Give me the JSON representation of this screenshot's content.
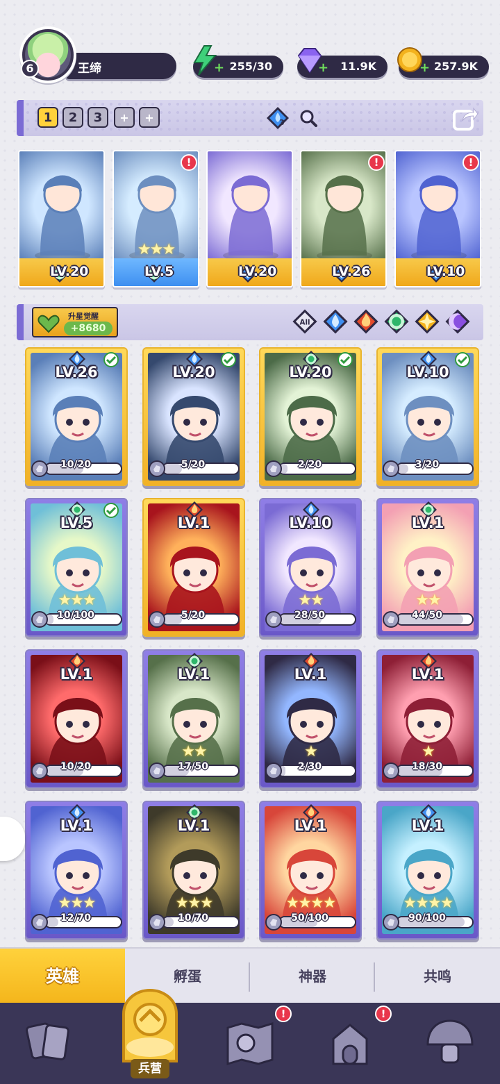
{
  "player": {
    "level": "6",
    "name": "王缔"
  },
  "resources": [
    {
      "key": "energy",
      "value": "255/30",
      "icon": "lightning-icon",
      "color": "#3fd07a"
    },
    {
      "key": "gems",
      "value": "11.9K",
      "icon": "gem-icon",
      "color": "#8a63f0"
    },
    {
      "key": "gold",
      "value": "257.9K",
      "icon": "coin-icon",
      "color": "#f3b21d"
    }
  ],
  "team_bar": {
    "tabs": [
      "1",
      "2",
      "3",
      "+",
      "+"
    ],
    "active_tab": "1",
    "element_count": "3"
  },
  "team_slots": [
    {
      "level": "LV.20",
      "element": "nature",
      "bar": "gold",
      "alert": false
    },
    {
      "level": "LV.5",
      "element": "nature",
      "bar": "blue",
      "alert": true,
      "stars": "★★★"
    },
    {
      "level": "LV.20",
      "element": "water",
      "bar": "gold",
      "alert": false
    },
    {
      "level": "LV.26",
      "element": "water",
      "bar": "gold",
      "alert": true
    },
    {
      "level": "LV.10",
      "element": "water",
      "bar": "gold",
      "alert": true
    }
  ],
  "filter_bar": {
    "awaken_title": "升星觉醒",
    "awaken_value": "+8680",
    "filters": [
      "All",
      "water",
      "fire",
      "nature",
      "light",
      "dark"
    ]
  },
  "heroes": [
    {
      "level": "LV.26",
      "shards": "10/20",
      "progress": 0.5,
      "element": "water",
      "frame": "gold",
      "checked": true,
      "stars": ""
    },
    {
      "level": "LV.20",
      "shards": "5/20",
      "progress": 0.25,
      "element": "water",
      "frame": "gold",
      "checked": true,
      "stars": ""
    },
    {
      "level": "LV.20",
      "shards": "2/20",
      "progress": 0.1,
      "element": "nature",
      "frame": "gold",
      "checked": true,
      "stars": ""
    },
    {
      "level": "LV.10",
      "shards": "3/20",
      "progress": 0.15,
      "element": "water",
      "frame": "gold",
      "checked": true,
      "stars": ""
    },
    {
      "level": "LV.5",
      "shards": "10/100",
      "progress": 0.1,
      "element": "nature",
      "frame": "purple",
      "checked": true,
      "stars": "★★★"
    },
    {
      "level": "LV.1",
      "shards": "5/20",
      "progress": 0.25,
      "element": "fire",
      "frame": "gold",
      "checked": false,
      "stars": ""
    },
    {
      "level": "LV.10",
      "shards": "28/50",
      "progress": 0.56,
      "element": "water",
      "frame": "purple",
      "checked": false,
      "stars": "★★"
    },
    {
      "level": "LV.1",
      "shards": "44/50",
      "progress": 0.88,
      "element": "nature",
      "frame": "purple",
      "checked": false,
      "stars": "★★"
    },
    {
      "level": "LV.1",
      "shards": "10/20",
      "progress": 0.5,
      "element": "fire",
      "frame": "purple",
      "checked": false,
      "stars": ""
    },
    {
      "level": "LV.1",
      "shards": "17/50",
      "progress": 0.34,
      "element": "nature",
      "frame": "purple",
      "checked": false,
      "stars": "★★"
    },
    {
      "level": "LV.1",
      "shards": "2/30",
      "progress": 0.07,
      "element": "fire",
      "frame": "purple",
      "checked": false,
      "stars": "★"
    },
    {
      "level": "LV.1",
      "shards": "18/30",
      "progress": 0.6,
      "element": "fire",
      "frame": "purple",
      "checked": false,
      "stars": "★"
    },
    {
      "level": "LV.1",
      "shards": "12/70",
      "progress": 0.17,
      "element": "water",
      "frame": "purple",
      "checked": false,
      "stars": "★★★"
    },
    {
      "level": "LV.1",
      "shards": "10/70",
      "progress": 0.14,
      "element": "nature",
      "frame": "purple",
      "checked": false,
      "stars": "★★★"
    },
    {
      "level": "LV.1",
      "shards": "50/100",
      "progress": 0.5,
      "element": "fire",
      "frame": "purple",
      "checked": false,
      "stars": "★★★★"
    },
    {
      "level": "LV.1",
      "shards": "90/100",
      "progress": 0.9,
      "element": "water",
      "frame": "purple",
      "checked": false,
      "stars": "★★★★"
    }
  ],
  "subtabs": [
    "英雄",
    "孵蛋",
    "神器",
    "共鸣"
  ],
  "navbar": [
    {
      "icon": "cards-icon",
      "label": "",
      "alert": false
    },
    {
      "icon": "barracks-icon",
      "label": "兵营",
      "alert": false,
      "active": true
    },
    {
      "icon": "map-icon",
      "label": "",
      "alert": true
    },
    {
      "icon": "shrine-icon",
      "label": "",
      "alert": true
    },
    {
      "icon": "mushroom-icon",
      "label": "",
      "alert": false
    }
  ],
  "alert_mark": "!",
  "colors": {
    "water": "#3f8ff0",
    "fire": "#e24b2c",
    "nature": "#2fb66a",
    "light": "#f4b31d",
    "dark": "#8a4fe0",
    "panel": "#2f2a45",
    "accent": "#7b6bd4",
    "gold": "#f4b51b"
  }
}
